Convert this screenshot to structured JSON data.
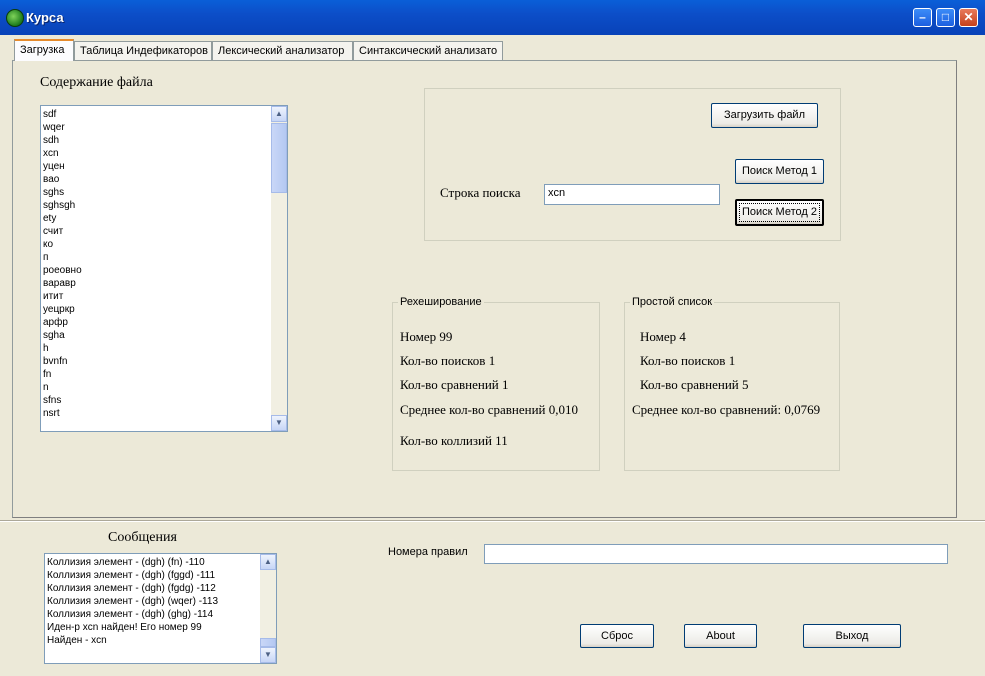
{
  "window": {
    "title": "Курса"
  },
  "tabs": [
    "Загрузка",
    "Таблица Индефикаторов",
    "Лексический анализатор",
    "Синтаксический анализато"
  ],
  "file_panel": {
    "label": "Содержание файла",
    "items": [
      "sdf",
      "wqer",
      "sdh",
      "xcn",
      "уцен",
      "вао",
      "sghs",
      "sghsgh",
      "ety",
      "счит",
      "ко",
      "п",
      "роеовно",
      "варавр",
      "итит",
      "уецркр",
      "арфр",
      "sgha",
      "h",
      "bvnfn",
      "fn",
      "n",
      "sfns",
      "nsrt"
    ]
  },
  "search_box": {
    "load_button": "Загрузить файл",
    "search_label": "Строка поиска",
    "search_value": "xcn",
    "method1_button": "Поиск Метод 1",
    "method2_button": "Поиск Метод 2"
  },
  "rehash_group": {
    "title": "Рехеширование",
    "number": "Номер 99",
    "searches": "Кол-во поисков 1",
    "comparisons": "Кол-во сравнений 1",
    "avg": "Среднее кол-во сравнений 0,010",
    "collisions": "Кол-во коллизий 11"
  },
  "simple_group": {
    "title": "Простой список",
    "number": "Номер 4",
    "searches": "Кол-во поисков 1",
    "comparisons": "Кол-во сравнений 5",
    "avg": "Среднее кол-во сравнений: 0,0769"
  },
  "messages": {
    "label": "Сообщения",
    "items": [
      "Коллизия элемент - (dgh)  (fn) -110",
      "Коллизия элемент - (dgh)  (fggd) -111",
      "Коллизия элемент - (dgh)  (fgdg) -112",
      "Коллизия элемент - (dgh)  (wqer) -113",
      "Коллизия элемент - (dgh)  (ghg) -114",
      "Иден-р  xcn найден! Его номер 99",
      "Найден - xcn"
    ]
  },
  "rules": {
    "label": "Номера  правил",
    "value": ""
  },
  "bottom_buttons": {
    "reset": "Сброс",
    "about": "About",
    "exit": "Выход"
  }
}
